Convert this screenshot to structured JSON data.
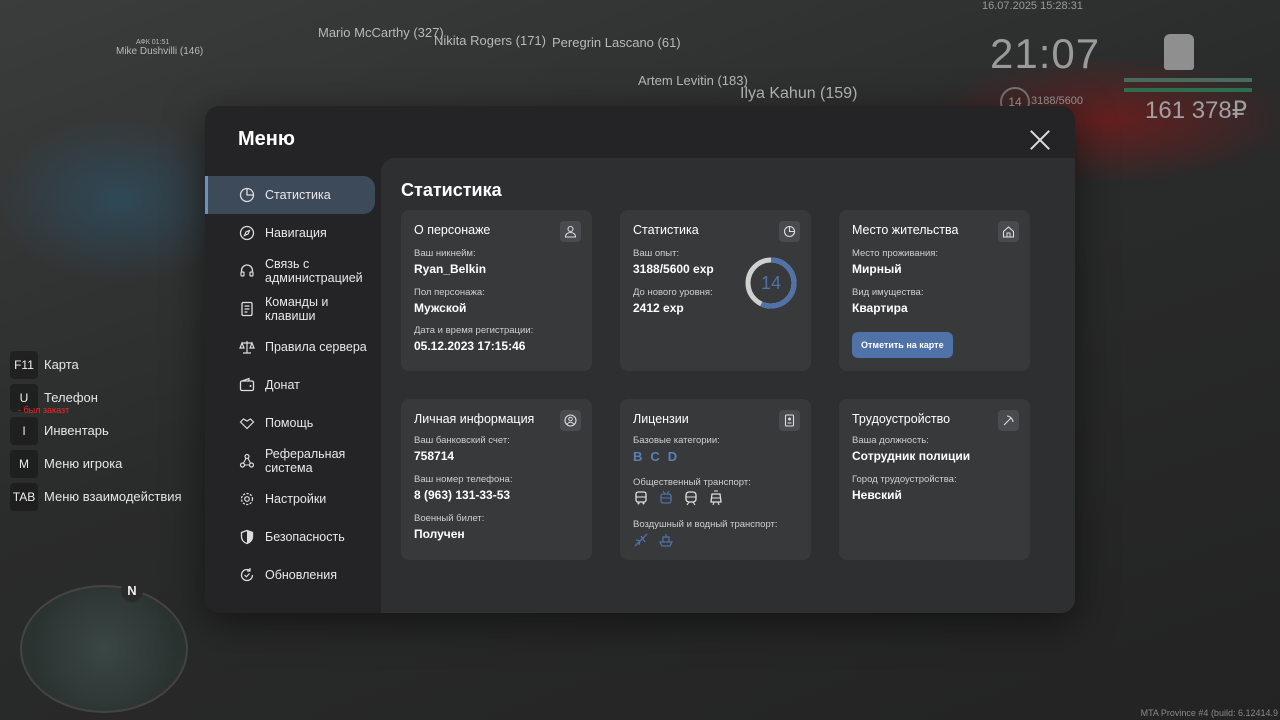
{
  "world": {
    "nicknames": [
      {
        "text": "Mario McCarthy (327)"
      },
      {
        "text": "Nikita Rogers (171)"
      },
      {
        "text": "Peregrin Lascano (61)"
      },
      {
        "text": "Artem Levitin (183)"
      },
      {
        "text": "Ilya Kahun (159)"
      },
      {
        "text": "Mike Dushvilli (146)"
      }
    ],
    "afk_tag": "АФК 01:51"
  },
  "hud": {
    "date": "16.07.2025 15:28:31",
    "time": "21:07",
    "money": "161 378₽",
    "level": "14",
    "exp": "3188/5600",
    "colors": {
      "hp": "#2e6e4f",
      "armor": "#4a6a5d",
      "money": "#a0a0a0"
    }
  },
  "hotkeys": [
    {
      "key": "F11",
      "label": "Карта"
    },
    {
      "key": "U",
      "label": "Телефон"
    },
    {
      "key": "I",
      "label": "Инвентарь"
    },
    {
      "key": "M",
      "label": "Меню игрока"
    },
    {
      "key": "TAB",
      "label": "Меню взаимодействия"
    }
  ],
  "hotkey_warning": "- был заказт",
  "minimap": {
    "north": "N"
  },
  "build": "MTA Province #4 (build: 6.12414.9",
  "menu": {
    "title": "Меню",
    "accent": "#4f72a8",
    "sidebar": [
      {
        "label": "Статистика",
        "icon": "pie-chart-icon",
        "active": true
      },
      {
        "label": "Навигация",
        "icon": "compass-icon"
      },
      {
        "label": "Связь с администрацией",
        "icon": "headset-icon"
      },
      {
        "label": "Команды и клавиши",
        "icon": "document-icon"
      },
      {
        "label": "Правила сервера",
        "icon": "scales-icon"
      },
      {
        "label": "Донат",
        "icon": "wallet-icon"
      },
      {
        "label": "Помощь",
        "icon": "handshake-icon"
      },
      {
        "label": "Реферальная система",
        "icon": "network-icon"
      },
      {
        "label": "Настройки",
        "icon": "gear-icon"
      },
      {
        "label": "Безопасность",
        "icon": "shield-icon"
      },
      {
        "label": "Обновления",
        "icon": "refresh-icon"
      }
    ],
    "section_title": "Статистика",
    "cards": {
      "character": {
        "title": "О персонаже",
        "icon": "user-icon",
        "nick_label": "Ваш никнейм:",
        "nick": "Ryan_Belkin",
        "gender_label": "Пол персонажа:",
        "gender": "Мужской",
        "reg_label": "Дата и время регистрации:",
        "reg": "05.12.2023 17:15:46"
      },
      "stats": {
        "title": "Статистика",
        "icon": "pie-chart-icon",
        "exp_label": "Ваш опыт:",
        "exp": "3188/5600 exp",
        "next_label": "До нового уровня:",
        "next": "2412 exp",
        "level": "14",
        "progress": 0.569
      },
      "residence": {
        "title": "Место жительства",
        "icon": "home-icon",
        "place_label": "Место проживания:",
        "place": "Мирный",
        "property_label": "Вид имущества:",
        "property": "Квартира",
        "button": "Отметить на карте"
      },
      "personal": {
        "title": "Личная информация",
        "icon": "user-circle-icon",
        "bank_label": "Ваш банковский счет:",
        "bank": "758714",
        "phone_label": "Ваш номер телефона:",
        "phone": "8 (963) 131-33-53",
        "military_label": "Военный билет:",
        "military": "Получен"
      },
      "licenses": {
        "title": "Лицензии",
        "icon": "id-card-icon",
        "base_label": "Базовые категории:",
        "categories": [
          "B",
          "C",
          "D"
        ],
        "public_label": "Общественный транспорт:",
        "public_icons": [
          "bus-icon",
          "trolley-icon",
          "train-icon",
          "tram-icon"
        ],
        "air_label": "Воздушный и водный транспорт:",
        "air_icons": [
          "plane-icon",
          "boat-icon"
        ]
      },
      "job": {
        "title": "Трудоустройство",
        "icon": "pickaxe-icon",
        "position_label": "Ваша должность:",
        "position": "Сотрудник полиции",
        "city_label": "Город трудоустройства:",
        "city": "Невский"
      }
    }
  }
}
